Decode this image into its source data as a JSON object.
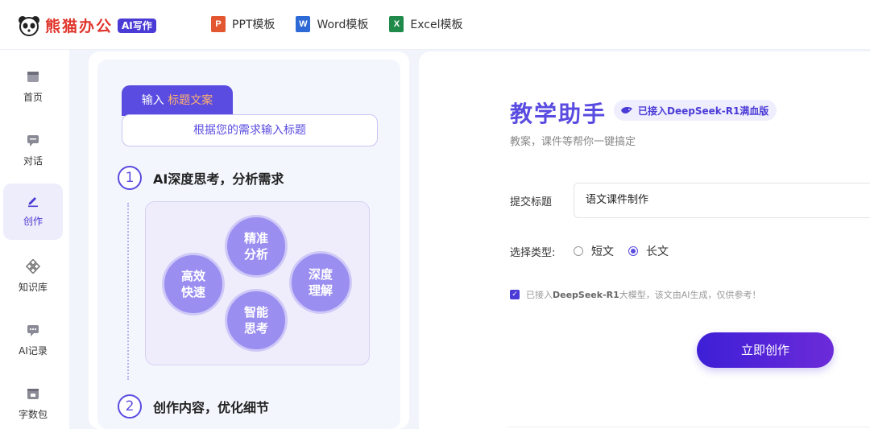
{
  "header": {
    "logo_text": "熊猫办公",
    "logo_badge": "AI写作",
    "nav": [
      {
        "label": "PPT模板",
        "icon": "ppt-icon",
        "icon_letter": "P",
        "color": "#e2572f"
      },
      {
        "label": "Word模板",
        "icon": "word-icon",
        "icon_letter": "W",
        "color": "#2d6ad6"
      },
      {
        "label": "Excel模板",
        "icon": "excel-icon",
        "icon_letter": "X",
        "color": "#1f8a4a"
      }
    ]
  },
  "sidebar": {
    "items": [
      {
        "label": "首页",
        "icon": "home-icon"
      },
      {
        "label": "对话",
        "icon": "chat-icon"
      },
      {
        "label": "创作",
        "icon": "pen-icon",
        "active": true
      },
      {
        "label": "知识库",
        "icon": "knowledge-icon"
      },
      {
        "label": "AI记录",
        "icon": "record-icon"
      },
      {
        "label": "字数包",
        "icon": "package-icon"
      }
    ]
  },
  "guide": {
    "tab_prefix": "输入",
    "tab_highlight": "标题文案",
    "input_hint": "根据您的需求输入标题",
    "step1_num": "1",
    "step1_title": "AI深度思考，分析需求",
    "bubbles": [
      "精准\n分析",
      "高效\n快速",
      "深度\n理解",
      "智能\n思考"
    ],
    "step2_num": "2",
    "step2_title": "创作内容，优化细节"
  },
  "main": {
    "title": "教学助手",
    "badge": "已接入DeepSeek-R1满血版",
    "subtitle": "教案，课件等帮你一键搞定",
    "submit_label": "提交标题",
    "submit_value": "语文课件制作",
    "type_label": "选择类型:",
    "type_options": [
      "短文",
      "长文"
    ],
    "type_selected": "长文",
    "notice_prefix": "已接入",
    "notice_bold": "DeepSeek-R1",
    "notice_suffix": "大模型，该文由AI生成，仅供参考！",
    "create_button": "立即创作"
  },
  "colors": {
    "accent": "#5a4ce0",
    "brand_red": "#e0342b"
  }
}
